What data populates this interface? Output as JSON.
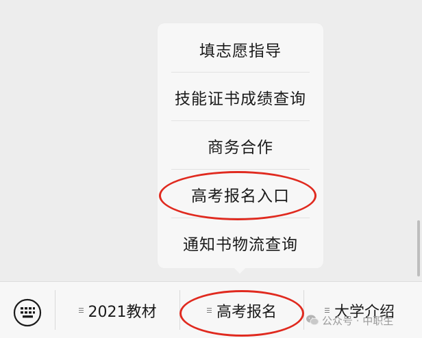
{
  "submenu": {
    "items": [
      {
        "label": "填志愿指导"
      },
      {
        "label": "技能证书成绩查询"
      },
      {
        "label": "商务合作"
      },
      {
        "label": "高考报名入口"
      },
      {
        "label": "通知书物流查询"
      }
    ]
  },
  "bottom_menu": {
    "items": [
      {
        "label": "2021教材"
      },
      {
        "label": "高考报名"
      },
      {
        "label": "大学介绍"
      }
    ]
  },
  "watermark": {
    "text": "公众号 · 中职生"
  },
  "colors": {
    "annotation": "#e02a1f",
    "background": "#ededed",
    "surface": "#f7f7f7",
    "text": "#1a1a1a"
  }
}
